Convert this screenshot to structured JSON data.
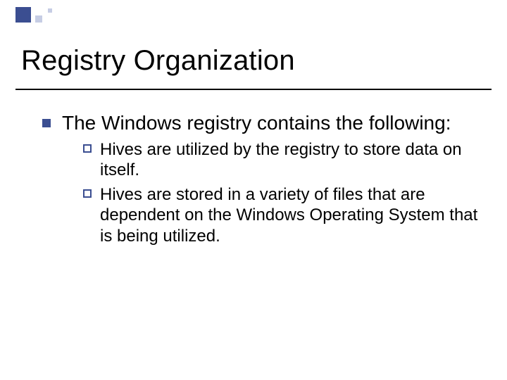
{
  "title": "Registry Organization",
  "body": {
    "item1": {
      "text": "The Windows registry contains the following:",
      "sub": [
        "Hives are utilized by the registry to store data on itself.",
        "Hives are stored in a variety of files that are dependent on the Windows Operating System that is being utilized."
      ]
    }
  }
}
